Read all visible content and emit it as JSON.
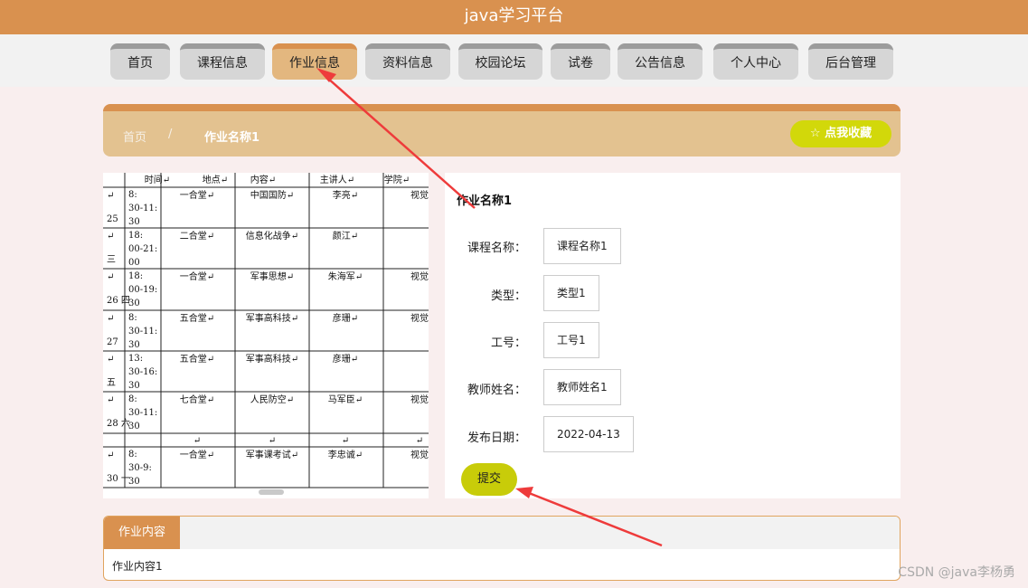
{
  "header": {
    "title": "java学习平台"
  },
  "nav": {
    "items": [
      {
        "label": "首页"
      },
      {
        "label": "课程信息"
      },
      {
        "label": "作业信息"
      },
      {
        "label": "资料信息"
      },
      {
        "label": "校园论坛"
      },
      {
        "label": "试卷"
      },
      {
        "label": "公告信息"
      },
      {
        "label": "个人中心"
      },
      {
        "label": "后台管理"
      }
    ],
    "active": "作业信息"
  },
  "breadcrumb": {
    "home": "首页",
    "separator": "/",
    "current": "作业名称1"
  },
  "favorite_button": {
    "label": "点我收藏",
    "icon": "star-outline-icon"
  },
  "detail": {
    "title": "作业名称1",
    "fields": [
      {
        "label": "课程名称：",
        "value": "课程名称1"
      },
      {
        "label": "类型：",
        "value": "类型1"
      },
      {
        "label": "工号：",
        "value": "工号1"
      },
      {
        "label": "教师姓名：",
        "value": "教师姓名1"
      },
      {
        "label": "发布日期：",
        "value": "2022-04-13"
      }
    ],
    "submit_label": "提交"
  },
  "schedule_image": {
    "headers": [
      "时间",
      "地点",
      "内容",
      "主讲人",
      "学院"
    ],
    "rows": [
      {
        "date": "25",
        "time": [
          "8:",
          "30-11:",
          "30"
        ],
        "place": "一合堂",
        "content": "中国国防",
        "speaker": "李亮",
        "college": "视觉"
      },
      {
        "date": "三",
        "time": [
          "18:",
          "00-21:",
          "00"
        ],
        "place": "二合堂",
        "content": "信息化战争",
        "speaker": "颜江",
        "college": ""
      },
      {
        "date": "26 四",
        "time": [
          "18:",
          "00-19:",
          "30"
        ],
        "place": "一合堂",
        "content": "军事思想",
        "speaker": "朱海军",
        "college": "视觉"
      },
      {
        "date": "27",
        "time": [
          "8:",
          "30-11:",
          "30"
        ],
        "place": "五合堂",
        "content": "军事高科技",
        "speaker": "彦珊",
        "college": "视觉"
      },
      {
        "date": "五",
        "time": [
          "13:",
          "30-16:",
          "30"
        ],
        "place": "五合堂",
        "content": "军事高科技",
        "speaker": "彦珊",
        "college": ""
      },
      {
        "date": "28 六",
        "time": [
          "8:",
          "30-11:",
          "30"
        ],
        "place": "七合堂",
        "content": "人民防空",
        "speaker": "马军臣",
        "college": "视觉"
      },
      {
        "date": "30 一",
        "time": [
          "8:",
          "30-9:",
          "30"
        ],
        "place": "一合堂",
        "content": "军事课考试",
        "speaker": "李忠诚",
        "college": "视觉"
      }
    ]
  },
  "tabs": {
    "items": [
      {
        "label": "作业内容"
      }
    ],
    "content": "作业内容1"
  },
  "watermark": "CSDN @java李杨勇",
  "colors": {
    "header": "#d9914f",
    "nav_active": "#e3b77f",
    "button_yellow": "#c8cc09",
    "annotation_red": "#ee3b3b"
  }
}
